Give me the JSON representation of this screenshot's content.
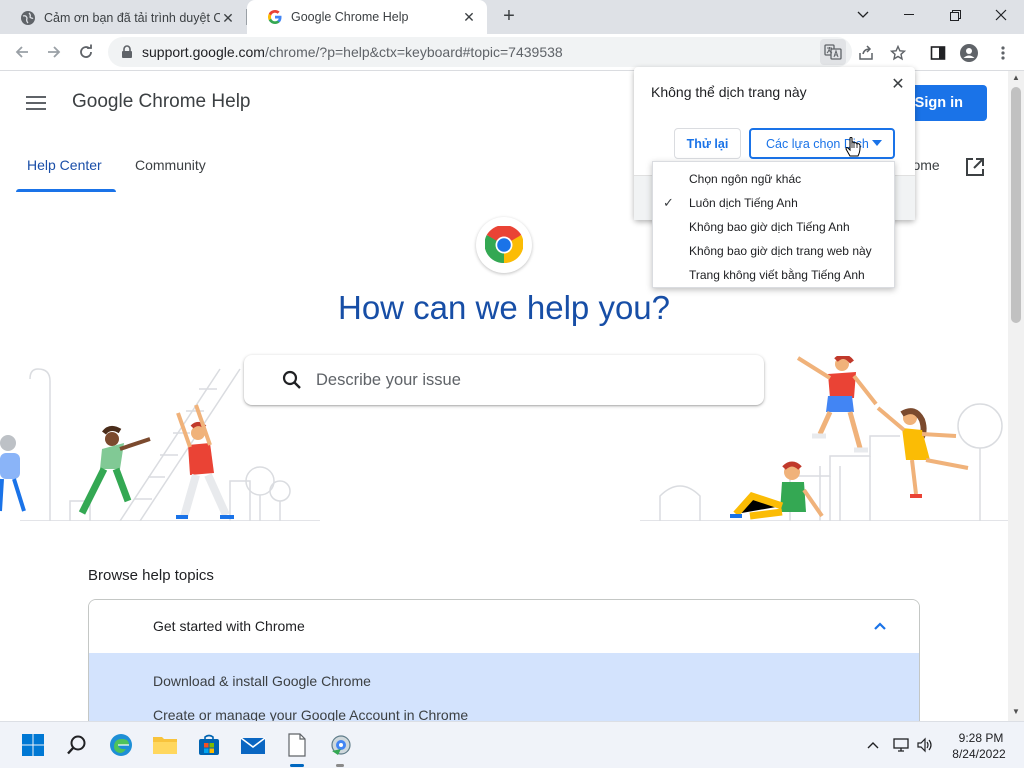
{
  "browser": {
    "tabs": [
      {
        "title": "Cảm ơn bạn đã tải trình duyệt Chrome",
        "icon": "globe-icon",
        "active": false
      },
      {
        "title": "Google Chrome Help",
        "icon": "google-icon",
        "active": true
      }
    ],
    "url_host": "support.google.com",
    "url_path": "/chrome/?p=help&ctx=keyboard#topic=7439538"
  },
  "site": {
    "title": "Google Chrome Help",
    "sign_in": "Sign in",
    "nav_tabs": [
      "Help Center",
      "Community"
    ],
    "chrome_link": "hrome",
    "hero": "How can we help you?",
    "search_placeholder": "Describe your issue",
    "browse_title": "Browse help topics",
    "topic_header": "Get started with Chrome",
    "topic_items": [
      "Download & install Google Chrome",
      "Create or manage your Google Account in Chrome"
    ]
  },
  "translate": {
    "title": "Không thể dịch trang này",
    "retry": "Thử lại",
    "options": "Các lựa chọn Dịch",
    "menu": [
      {
        "label": "Chọn ngôn ngữ khác",
        "checked": false
      },
      {
        "label": "Luôn dịch Tiếng Anh",
        "checked": true
      },
      {
        "label": "Không bao giờ dịch Tiếng Anh",
        "checked": false
      },
      {
        "label": "Không bao giờ dịch trang web này",
        "checked": false
      },
      {
        "label": "Trang không viết bằng Tiếng Anh",
        "checked": false
      }
    ],
    "check_glyph": "✓"
  },
  "taskbar": {
    "time": "9:28 PM",
    "date": "8/24/2022",
    "apps": [
      "windows-start-icon",
      "search-icon",
      "edge-icon",
      "file-explorer-icon",
      "store-icon",
      "mail-icon",
      "notepad-icon",
      "setup-icon"
    ]
  },
  "colors": {
    "accent": "#1a73e8",
    "hero_text": "#174ea6",
    "topic_highlight": "#d3e3fd"
  }
}
